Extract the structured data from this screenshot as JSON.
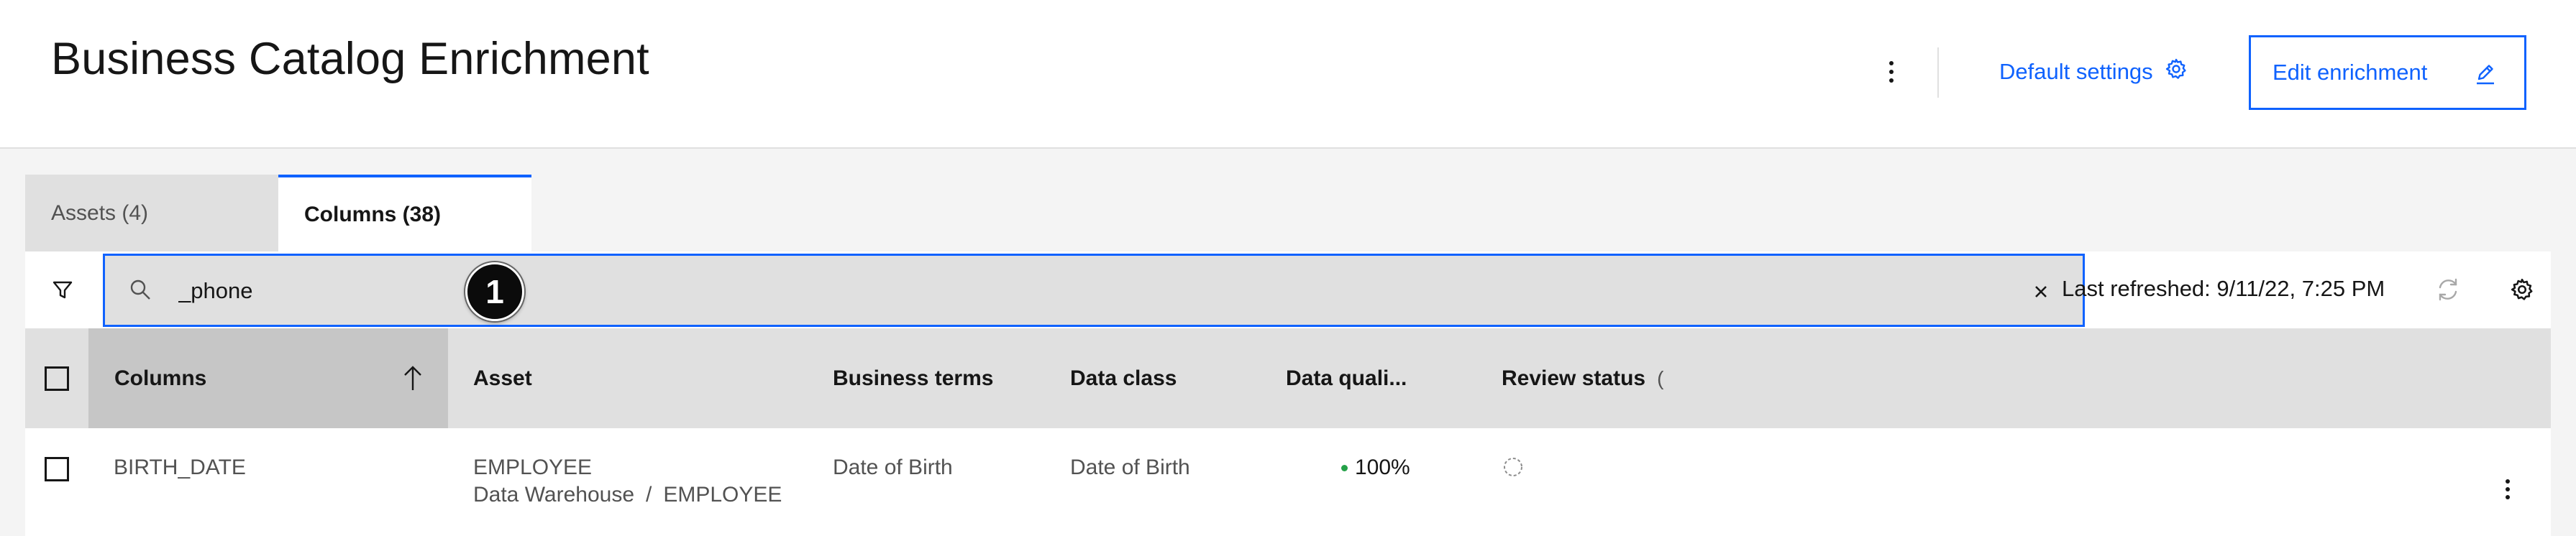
{
  "header": {
    "title": "Business Catalog Enrichment",
    "default_settings_label": "Default settings",
    "edit_enrichment_label": "Edit enrichment"
  },
  "tabs": [
    {
      "label": "Assets (4)",
      "selected": false
    },
    {
      "label": "Columns (38)",
      "selected": true
    }
  ],
  "toolbar": {
    "search_value": "_phone",
    "step_badge": "1",
    "last_refreshed": "Last refreshed: 9/11/22, 7:25 PM"
  },
  "table": {
    "headers": {
      "columns": "Columns",
      "asset": "Asset",
      "business_terms": "Business terms",
      "data_class": "Data class",
      "data_quality": "Data quali...",
      "review_status": "Review status",
      "review_status_info": "("
    },
    "rows": [
      {
        "column": "BIRTH_DATE",
        "asset": "EMPLOYEE",
        "asset_path_parent": "Data Warehouse",
        "asset_path_separator": "/",
        "asset_path_child": "EMPLOYEE",
        "business_term": "Date of Birth",
        "data_class": "Date of Birth",
        "data_quality": "100%"
      }
    ]
  },
  "colors": {
    "accent": "#0f62fe",
    "quality_good": "#24a148",
    "header_bg": "#e0e0e0",
    "sorted_header_bg": "#c6c6c6"
  }
}
